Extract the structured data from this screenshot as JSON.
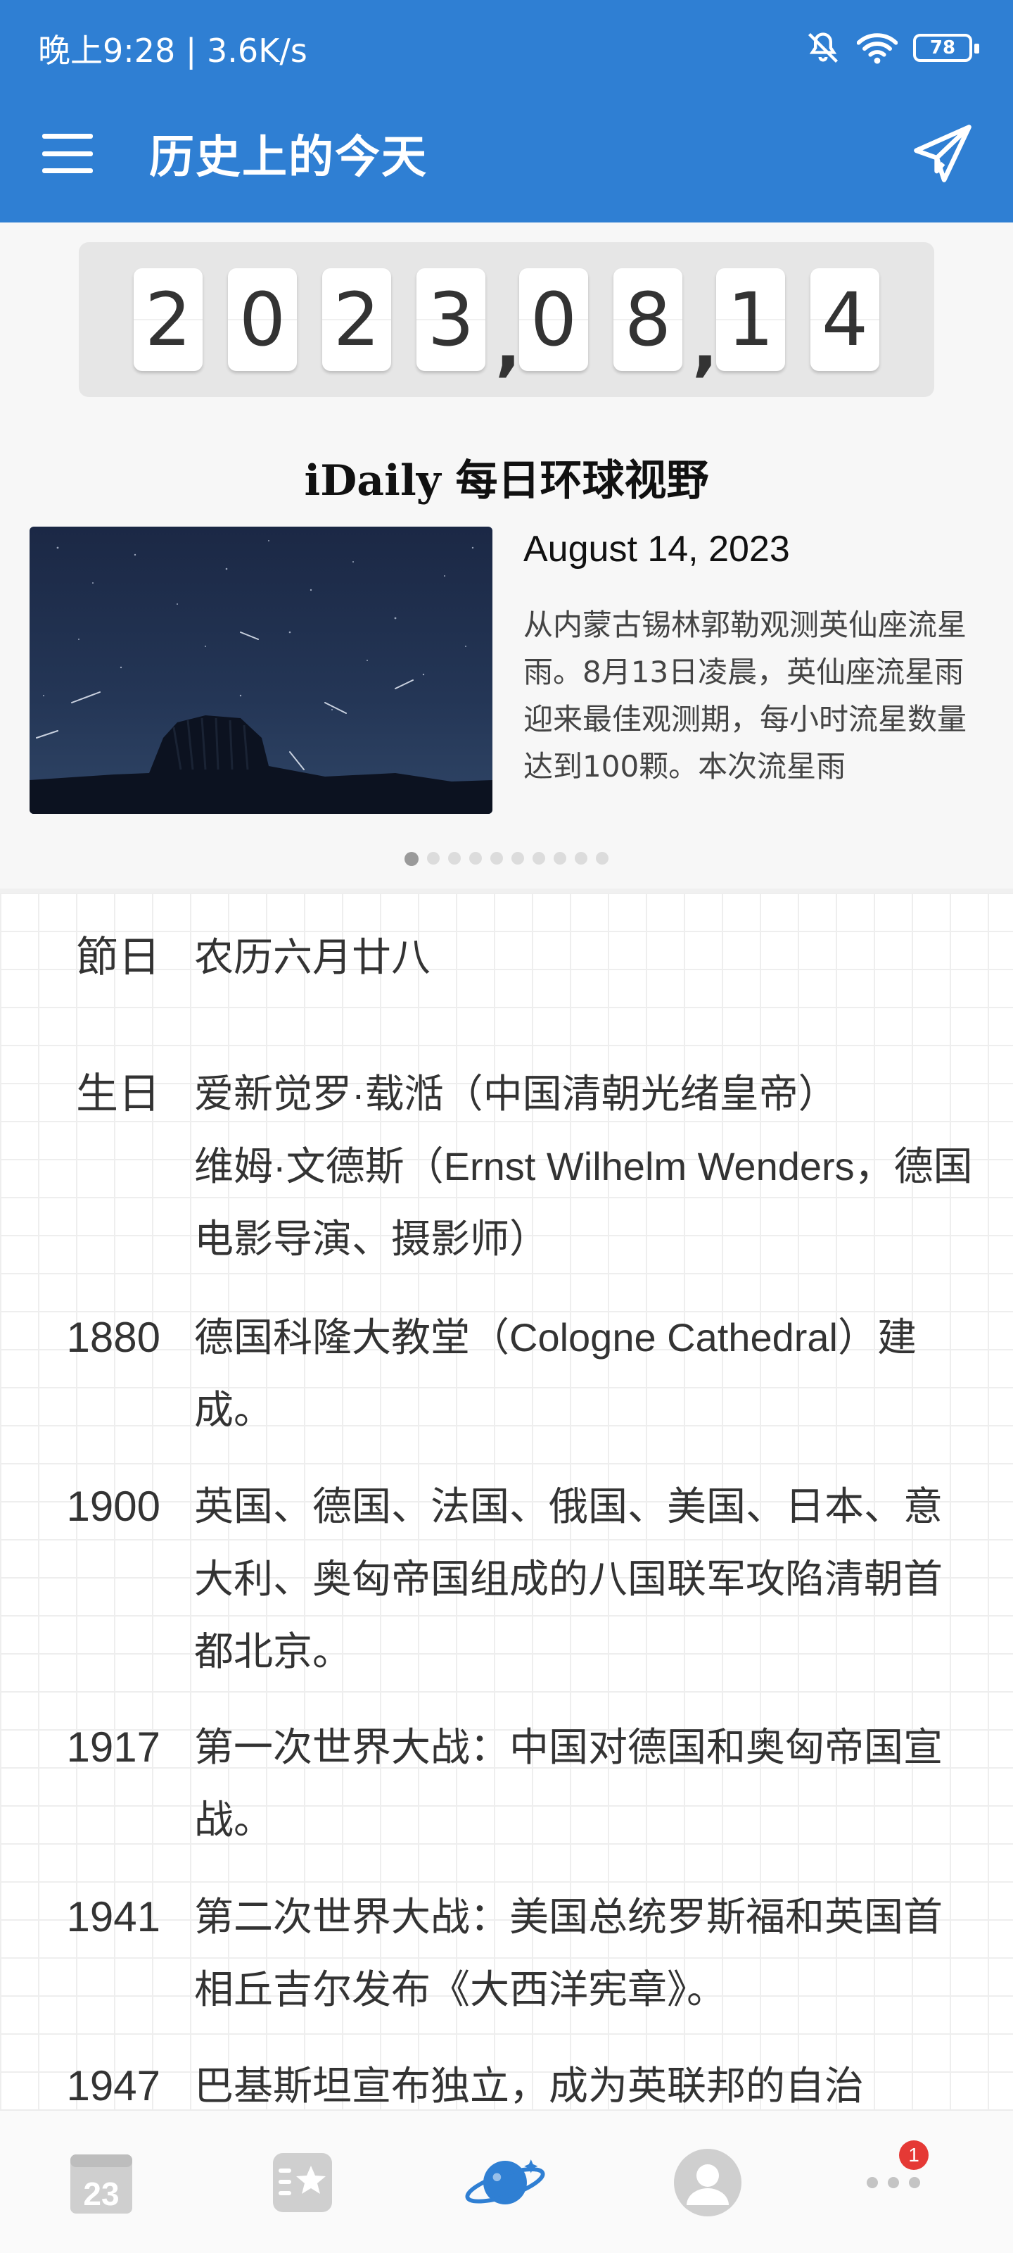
{
  "status_bar": {
    "time_speed": "晚上9:28 | 3.6K/s",
    "battery": "78"
  },
  "app_bar": {
    "title": "历史上的今天"
  },
  "date_display": {
    "digits": [
      "2",
      "0",
      "2",
      "3",
      "0",
      "8",
      "1",
      "4"
    ],
    "separator": ","
  },
  "idaily": {
    "title": "iDaily 每日环球视野",
    "date": "August 14, 2023",
    "text": "从内蒙古锡林郭勒观测英仙座流星雨。8月13日凌晨，英仙座流星雨迎来最佳观测期，每小时流星数量达到100颗。本次流星雨",
    "dots_total": 10,
    "active_dot": 0
  },
  "events": [
    {
      "label": "節日",
      "text": "农历六月廿八"
    },
    {
      "label": "生日",
      "text": "爱新觉罗·载湉（中国清朝光绪皇帝）"
    },
    {
      "label": "",
      "text": "维姆·文德斯（Ernst Wilhelm Wenders，德国电影导演、摄影师）"
    },
    {
      "label": "1880",
      "text": "德国科隆大教堂（Cologne Cathedral）建成。"
    },
    {
      "label": "1900",
      "text": "英国、德国、法国、俄国、美国、日本、意大利、奥匈帝国组成的八国联军攻陷清朝首都北京。"
    },
    {
      "label": "1917",
      "text": "第一次世界大战：中国对德国和奥匈帝国宣战。"
    },
    {
      "label": "1941",
      "text": "第二次世界大战：美国总统罗斯福和英国首相丘吉尔发布《大西洋宪章》。"
    },
    {
      "label": "1947",
      "text": "巴基斯坦宣布独立，成为英联邦的自治"
    }
  ],
  "bottom_nav": {
    "calendar_day": "23",
    "more_badge": "1"
  }
}
